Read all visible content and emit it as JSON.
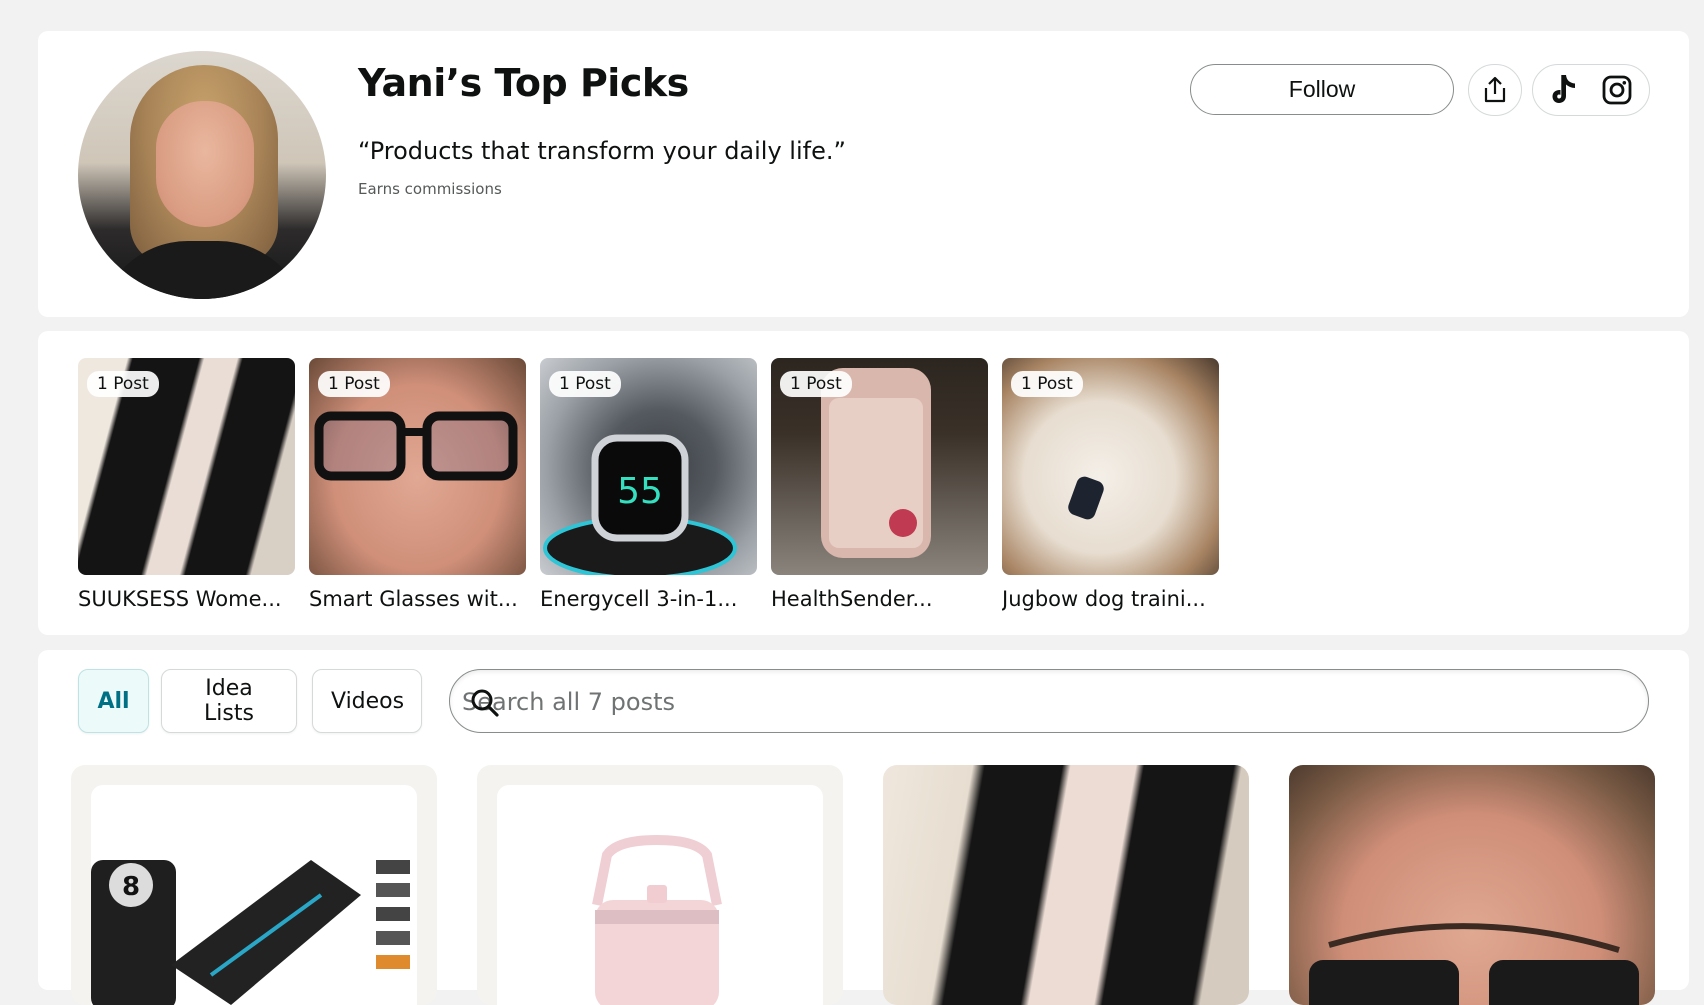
{
  "profile": {
    "title": "Yani’s Top Picks",
    "tagline": "“Products that transform your daily life.”",
    "commission_note": "Earns commissions",
    "follow_label": "Follow",
    "share_icon": "share-icon",
    "social_icons": [
      "tiktok-icon",
      "instagram-icon"
    ]
  },
  "storefront": {
    "tiles": [
      {
        "badge": "1 Post",
        "label": "SUUKSESS Wome..."
      },
      {
        "badge": "1 Post",
        "label": "Smart Glasses wit..."
      },
      {
        "badge": "1 Post",
        "label": "Energycell 3-in-1..."
      },
      {
        "badge": "1 Post",
        "label": "HealthSender..."
      },
      {
        "badge": "1 Post",
        "label": "Jugbow dog traini..."
      }
    ]
  },
  "feed": {
    "tabs": [
      "All",
      "Idea Lists",
      "Videos"
    ],
    "active_tab": "All",
    "search_placeholder": "Search all 7 posts",
    "accent_color": "#007185",
    "active_tab_bg": "#edfafa"
  }
}
